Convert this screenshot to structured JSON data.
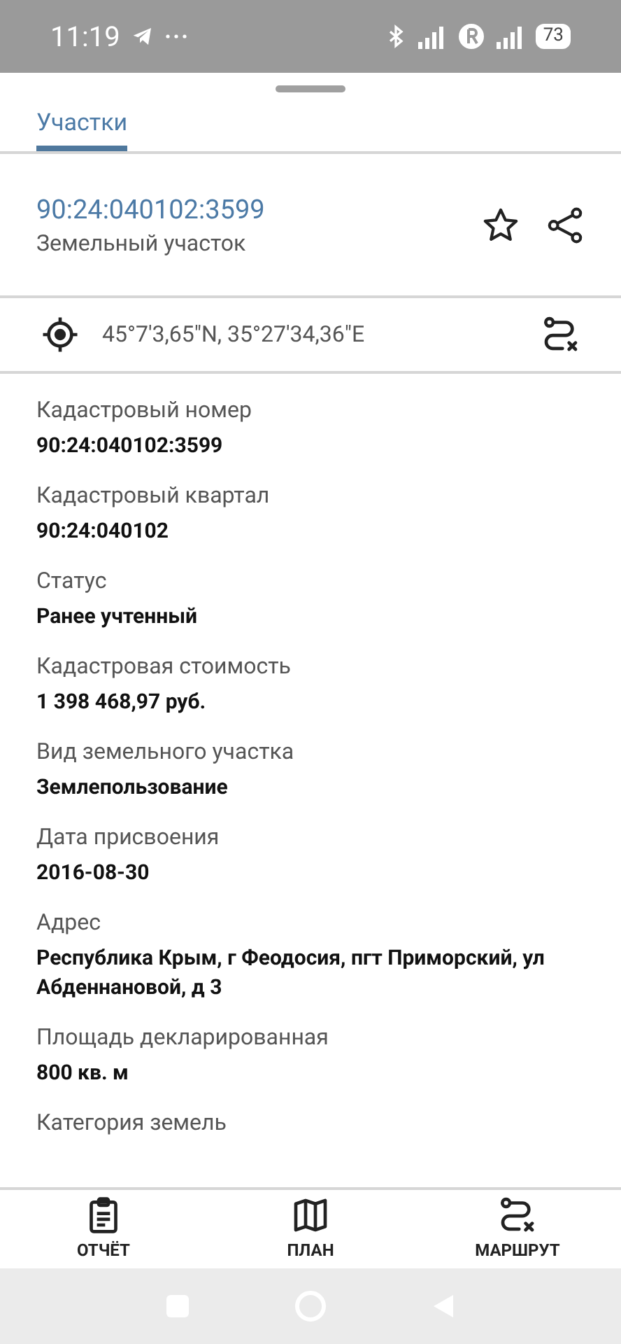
{
  "status_bar": {
    "time": "11:19",
    "battery": "73"
  },
  "tabs": [
    {
      "label": "Участки",
      "selected": true
    }
  ],
  "parcel": {
    "number": "90:24:040102:3599",
    "type": "Земельный участок"
  },
  "coordinates": "45°7'3,65\"N, 35°27'34,36\"E",
  "fields": [
    {
      "label": "Кадастровый номер",
      "value": "90:24:040102:3599"
    },
    {
      "label": "Кадастровый квартал",
      "value": "90:24:040102"
    },
    {
      "label": "Статус",
      "value": "Ранее учтенный"
    },
    {
      "label": "Кадастровая стоимость",
      "value": "1 398 468,97 руб."
    },
    {
      "label": "Вид земельного участка",
      "value": "Землепользование"
    },
    {
      "label": "Дата присвоения",
      "value": "2016-08-30"
    },
    {
      "label": "Адрес",
      "value": "Республика Крым, г Феодосия, пгт Приморский, ул Абденнановой, д 3"
    },
    {
      "label": "Площадь декларированная",
      "value": "800 кв. м"
    },
    {
      "label": "Категория земель"
    }
  ],
  "bottom_nav": [
    {
      "kind": "report",
      "label": "ОТЧЁТ"
    },
    {
      "kind": "plan",
      "label": "ПЛАН"
    },
    {
      "kind": "route",
      "label": "МАРШРУТ"
    }
  ]
}
